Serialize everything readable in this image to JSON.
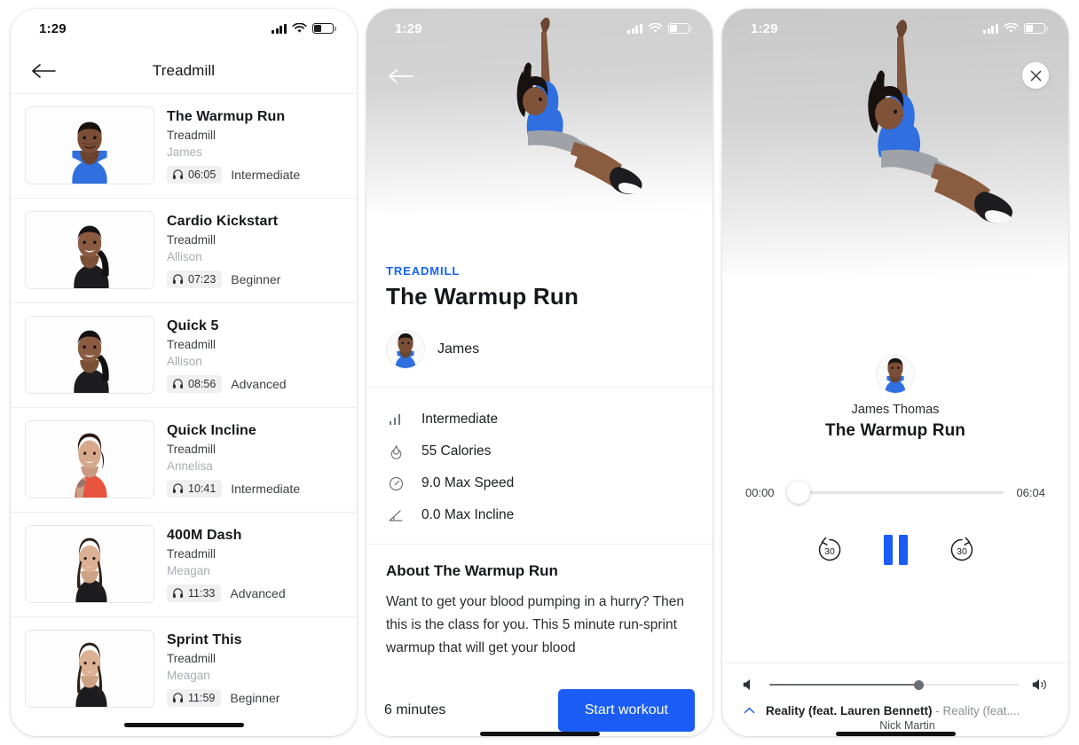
{
  "status_bar": {
    "time": "1:29",
    "signal_icon": "cellular-bars-icon",
    "wifi_icon": "wifi-icon",
    "battery_icon": "battery-icon"
  },
  "screen_list": {
    "nav": {
      "back_icon": "back-arrow-icon",
      "title": "Treadmill"
    },
    "classes": [
      {
        "title": "The Warmup Run",
        "category": "Treadmill",
        "instructor": "James",
        "duration": "06:05",
        "level": "Intermediate"
      },
      {
        "title": "Cardio Kickstart",
        "category": "Treadmill",
        "instructor": "Allison",
        "duration": "07:23",
        "level": "Beginner"
      },
      {
        "title": "Quick 5",
        "category": "Treadmill",
        "instructor": "Allison",
        "duration": "08:56",
        "level": "Advanced"
      },
      {
        "title": "Quick Incline",
        "category": "Treadmill",
        "instructor": "Annelisa",
        "duration": "10:41",
        "level": "Intermediate"
      },
      {
        "title": "400M Dash",
        "category": "Treadmill",
        "instructor": "Meagan",
        "duration": "11:33",
        "level": "Advanced"
      },
      {
        "title": "Sprint This",
        "category": "Treadmill",
        "instructor": "Meagan",
        "duration": "11:59",
        "level": "Beginner"
      }
    ],
    "headphone_icon": "headphones-icon",
    "home_indicator": "home-indicator"
  },
  "screen_detail": {
    "back_icon": "back-arrow-icon",
    "eyebrow": "TREADMILL",
    "title": "The Warmup Run",
    "instructor": "James",
    "stats": [
      {
        "icon": "bar-chart-icon",
        "text": "Intermediate"
      },
      {
        "icon": "flame-icon",
        "text": "55 Calories"
      },
      {
        "icon": "speedometer-icon",
        "text": "9.0 Max Speed"
      },
      {
        "icon": "angle-icon",
        "text": "0.0 Max Incline"
      }
    ],
    "about_heading": "About The Warmup Run",
    "about_text": "Want to get your blood pumping in a hurry? Then this is the class for you. This 5 minute run-sprint warmup that will get your blood",
    "duration_label": "6 minutes",
    "start_button": "Start workout",
    "accent_color": "#1a5cf5"
  },
  "screen_player": {
    "close_icon": "close-icon",
    "instructor": "James Thomas",
    "title": "The Warmup Run",
    "elapsed": "00:00",
    "total": "06:04",
    "progress_percent": 0,
    "controls": {
      "rewind_label": "30",
      "rewind_icon": "rewind-30-icon",
      "pause_icon": "pause-icon",
      "forward_label": "30",
      "forward_icon": "forward-30-icon"
    },
    "volume": {
      "mute_icon": "volume-low-icon",
      "max_icon": "volume-high-icon",
      "level_percent": 60
    },
    "now_playing": {
      "chevron_icon": "chevron-up-icon",
      "track_bold": "Reality (feat. Lauren Bennett)",
      "track_rest": " - Reality (feat....",
      "artist": "Nick Martin"
    }
  }
}
